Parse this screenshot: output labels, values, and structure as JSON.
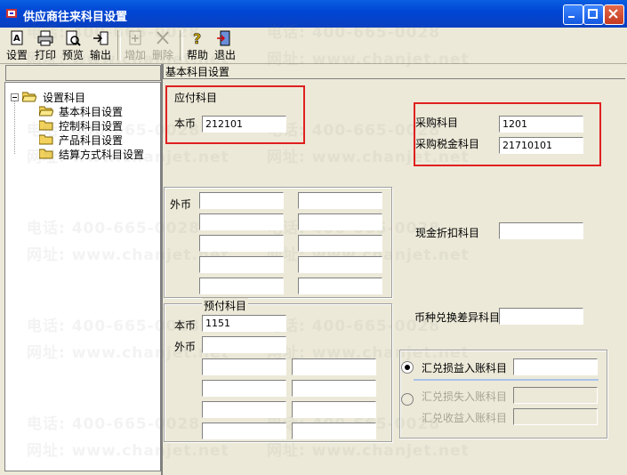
{
  "window": {
    "title": "供应商往来科目设置"
  },
  "toolbar": {
    "buttons": [
      {
        "label": "设置",
        "icon": "settings-doc-icon",
        "enabled": true
      },
      {
        "label": "打印",
        "icon": "printer-icon",
        "enabled": true
      },
      {
        "label": "预览",
        "icon": "preview-icon",
        "enabled": true
      },
      {
        "label": "输出",
        "icon": "export-icon",
        "enabled": true
      },
      {
        "label": "增加",
        "icon": "add-icon",
        "enabled": false
      },
      {
        "label": "删除",
        "icon": "delete-icon",
        "enabled": false
      },
      {
        "label": "帮助",
        "icon": "help-icon",
        "enabled": true
      },
      {
        "label": "退出",
        "icon": "exit-door-icon",
        "enabled": true
      }
    ]
  },
  "tree": {
    "root": "设置科目",
    "items": [
      "基本科目设置",
      "控制科目设置",
      "产品科目设置",
      "结算方式科目设置"
    ]
  },
  "panel": {
    "header": "基本科目设置"
  },
  "payable": {
    "group_label": "应付科目",
    "local_label": "本币",
    "local_value": "212101",
    "foreign_label": "外币"
  },
  "prepaid": {
    "group_label": "预付科目",
    "local_label": "本币",
    "local_value": "1151",
    "foreign_label": "外币"
  },
  "purchase": {
    "purchase_label": "采购科目",
    "purchase_value": "1201",
    "tax_label": "采购税金科目",
    "tax_value": "21710101"
  },
  "cash_discount_label": "现金折扣科目",
  "fx_diff_label": "币种兑换差异科目",
  "exchange": {
    "gain_loss_label": "汇兑损益入账科目",
    "loss_label": "汇兑损失入账科目",
    "income_label": "汇兑收益入账科目"
  },
  "watermark": {
    "phone": "电话: 400-665-0028",
    "site": "网址: www.chanjet.net"
  },
  "colors": {
    "titlebar": "#0046d5",
    "highlight_box": "#e02020",
    "background": "#ece9d8"
  }
}
